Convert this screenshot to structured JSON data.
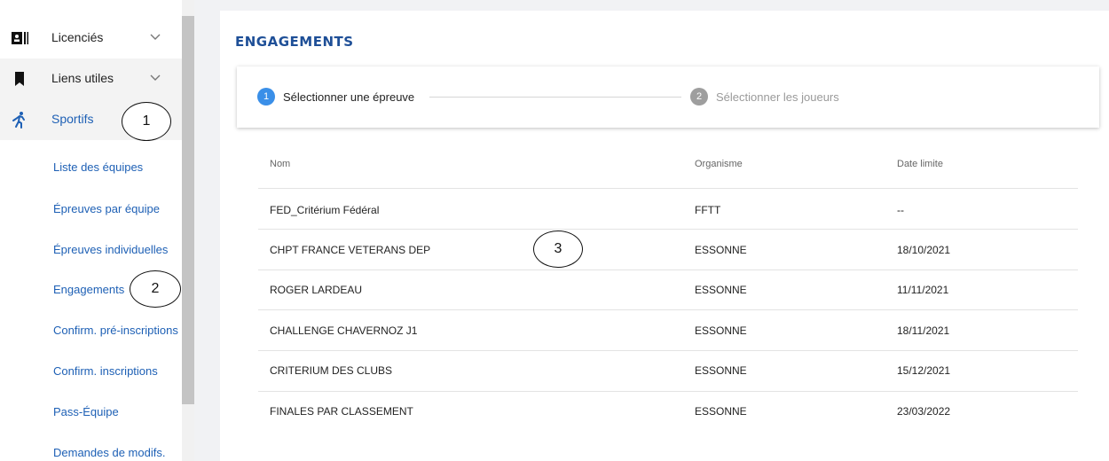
{
  "sidebar": {
    "top_items": [
      {
        "label": "Licenciés",
        "icon": "id-card-icon"
      },
      {
        "label": "Liens utiles",
        "icon": "bookmark-icon"
      },
      {
        "label": "Sportifs",
        "icon": "runner-icon"
      }
    ],
    "sub_items": [
      "Liste des équipes",
      "Épreuves par équipe",
      "Épreuves individuelles",
      "Engagements",
      "Confirm. pré-inscriptions",
      "Confirm. inscriptions",
      "Pass-Équipe",
      "Demandes de modifs."
    ]
  },
  "annotations": [
    "1",
    "2",
    "3"
  ],
  "main": {
    "title": "ENGAGEMENTS",
    "steps": [
      {
        "number": "1",
        "label": "Sélectionner une épreuve",
        "state": "active"
      },
      {
        "number": "2",
        "label": "Sélectionner les joueurs",
        "state": "inactive"
      }
    ],
    "table": {
      "headers": [
        "Nom",
        "Organisme",
        "Date limite"
      ],
      "rows": [
        [
          "FED_Critérium Fédéral",
          "FFTT",
          "--"
        ],
        [
          "CHPT FRANCE VETERANS DEP",
          "ESSONNE",
          "18/10/2021"
        ],
        [
          "ROGER LARDEAU",
          "ESSONNE",
          "11/11/2021"
        ],
        [
          "CHALLENGE CHAVERNOZ J1",
          "ESSONNE",
          "18/11/2021"
        ],
        [
          "CRITERIUM DES CLUBS",
          "ESSONNE",
          "15/12/2021"
        ],
        [
          "FINALES PAR CLASSEMENT",
          "ESSONNE",
          "23/03/2022"
        ]
      ]
    }
  },
  "colors": {
    "accent": "#1e60b5",
    "title": "#1e4f97",
    "step_active": "#3a8fe8",
    "step_inactive": "#9e9e9e"
  }
}
